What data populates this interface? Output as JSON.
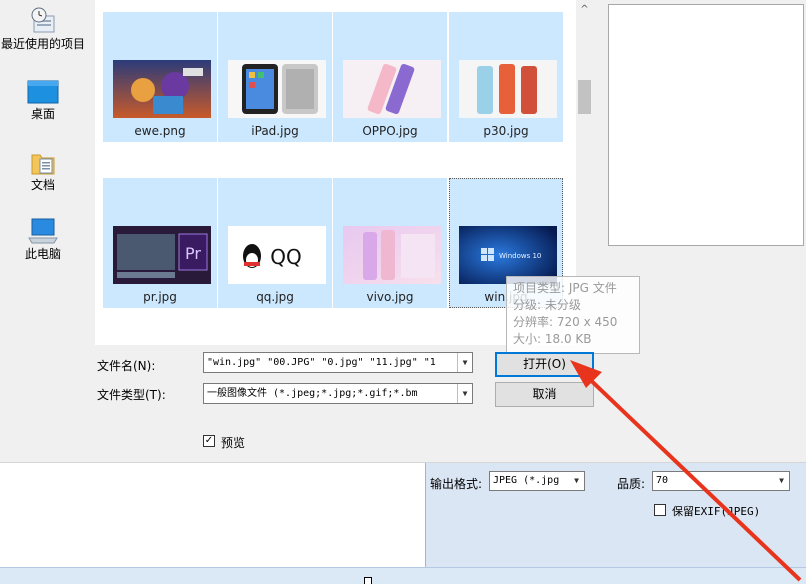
{
  "dialog": {
    "places": [
      {
        "label": "最近使用的项目",
        "icon": "recent-clock-icon"
      },
      {
        "label": "桌面",
        "icon": "desktop-icon"
      },
      {
        "label": "文档",
        "icon": "documents-folder-icon"
      },
      {
        "label": "此电脑",
        "icon": "this-pc-icon"
      }
    ],
    "files": [
      {
        "name": "ewe.png",
        "thumb": "game-art"
      },
      {
        "name": "iPad.jpg",
        "thumb": "ipad"
      },
      {
        "name": "OPPO.jpg",
        "thumb": "phone-pink"
      },
      {
        "name": "p30.jpg",
        "thumb": "phones-orange"
      },
      {
        "name": "pr.jpg",
        "thumb": "premiere"
      },
      {
        "name": "qq.jpg",
        "thumb": "qq-logo"
      },
      {
        "name": "vivo.jpg",
        "thumb": "phones-pastel"
      },
      {
        "name": "win.jpg",
        "thumb": "windows-10"
      }
    ],
    "tooltip": {
      "line1": "项目类型: JPG 文件",
      "line2": "分级: 未分级",
      "line3": "分辨率: 720 x 450",
      "line4": "大小: 18.0 KB"
    },
    "thumb_text": {
      "qq": "QQ",
      "pr": "Pr",
      "win": "Windows 10"
    },
    "filename_label": "文件名(N):",
    "filename_value": "\"win.jpg\" \"00.JPG\" \"0.jpg\" \"11.jpg\" \"1",
    "filetype_label": "文件类型(T):",
    "filetype_value": "一般图像文件 (*.jpeg;*.jpg;*.gif;*.bm",
    "open_button": "打开(O)",
    "cancel_button": "取消",
    "preview_checkbox": {
      "label": "预览",
      "checked": true,
      "mark": "☑"
    }
  },
  "app": {
    "output_format_label": "输出格式:",
    "output_format_value": "JPEG (*.jpg",
    "quality_label": "品质:",
    "quality_value": "70",
    "keep_exif_label": "保留EXIF(JPEG)",
    "keep_exif_checked": false
  },
  "colors": {
    "selection": "#cce8ff",
    "accent": "#0078d7",
    "arrow": "#e8341c"
  }
}
